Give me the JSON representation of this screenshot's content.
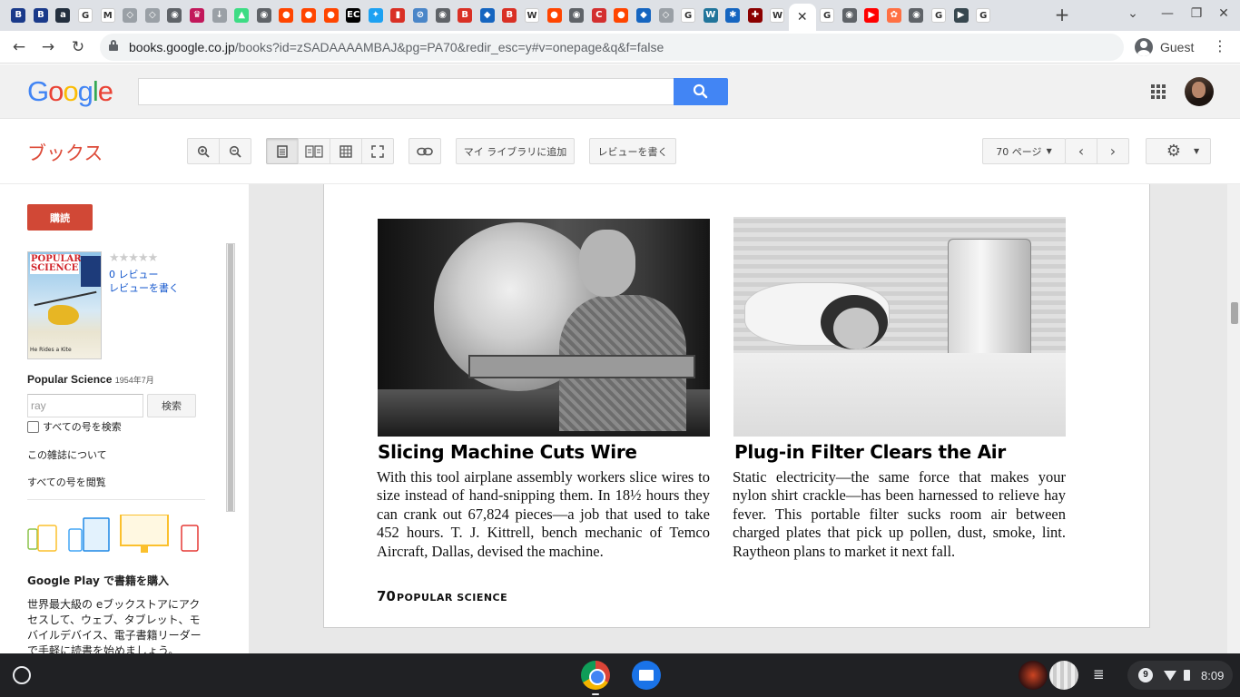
{
  "browser": {
    "tab_favicons": [
      {
        "icon": "bandai-icon",
        "color": "#1a3a8a",
        "glyph": "B"
      },
      {
        "icon": "bandai-icon",
        "color": "#1a3a8a",
        "glyph": "B"
      },
      {
        "icon": "amazon-icon",
        "color": "#232f3e",
        "glyph": "a"
      },
      {
        "icon": "google-icon",
        "color": "#ffffff",
        "glyph": "G"
      },
      {
        "icon": "gmail-icon",
        "color": "#ffffff",
        "glyph": "M"
      },
      {
        "icon": "shield-icon",
        "color": "#9aa0a6",
        "glyph": "◇"
      },
      {
        "icon": "shield-icon",
        "color": "#9aa0a6",
        "glyph": "◇"
      },
      {
        "icon": "globe-icon",
        "color": "#5f6368",
        "glyph": "◉"
      },
      {
        "icon": "crest-icon",
        "color": "#c2185b",
        "glyph": "♛"
      },
      {
        "icon": "arrow-icon",
        "color": "#9aa0a6",
        "glyph": "↓"
      },
      {
        "icon": "android-icon",
        "color": "#3ddc84",
        "glyph": "▲"
      },
      {
        "icon": "globe-icon",
        "color": "#5f6368",
        "glyph": "◉"
      },
      {
        "icon": "reddit-icon",
        "color": "#ff4500",
        "glyph": "●"
      },
      {
        "icon": "reddit-icon",
        "color": "#ff4500",
        "glyph": "●"
      },
      {
        "icon": "reddit-icon",
        "color": "#ff4500",
        "glyph": "●"
      },
      {
        "icon": "ec-icon",
        "color": "#000000",
        "glyph": "EC"
      },
      {
        "icon": "twitter-icon",
        "color": "#1da1f2",
        "glyph": "✦"
      },
      {
        "icon": "chart-icon",
        "color": "#d93025",
        "glyph": "▮"
      },
      {
        "icon": "slash-icon",
        "color": "#4a86c8",
        "glyph": "⊘"
      },
      {
        "icon": "globe-icon",
        "color": "#5f6368",
        "glyph": "◉"
      },
      {
        "icon": "books-icon",
        "color": "#d93025",
        "glyph": "B"
      },
      {
        "icon": "badge-icon",
        "color": "#1565c0",
        "glyph": "◆"
      },
      {
        "icon": "books-icon",
        "color": "#d93025",
        "glyph": "B"
      },
      {
        "icon": "wikipedia-icon",
        "color": "#ffffff",
        "glyph": "W"
      },
      {
        "icon": "reddit-icon",
        "color": "#ff4500",
        "glyph": "●"
      },
      {
        "icon": "globe-icon",
        "color": "#5f6368",
        "glyph": "◉"
      },
      {
        "icon": "c-icon",
        "color": "#d32f2f",
        "glyph": "C"
      },
      {
        "icon": "reddit-icon",
        "color": "#ff4500",
        "glyph": "●"
      },
      {
        "icon": "badge-icon",
        "color": "#1565c0",
        "glyph": "◆"
      },
      {
        "icon": "shield-icon",
        "color": "#9aa0a6",
        "glyph": "◇"
      },
      {
        "icon": "google-icon",
        "color": "#ffffff",
        "glyph": "G"
      },
      {
        "icon": "wordpress-icon",
        "color": "#21759b",
        "glyph": "W"
      },
      {
        "icon": "snowflake-icon",
        "color": "#1565c0",
        "glyph": "✱"
      },
      {
        "icon": "cross-icon",
        "color": "#8b0000",
        "glyph": "✚"
      },
      {
        "icon": "wikipedia-icon",
        "color": "#ffffff",
        "glyph": "W"
      }
    ],
    "tab_favicons_after": [
      {
        "icon": "google-icon",
        "color": "#ffffff",
        "glyph": "G"
      },
      {
        "icon": "globe-icon",
        "color": "#5f6368",
        "glyph": "◉"
      },
      {
        "icon": "youtube-icon",
        "color": "#ff0000",
        "glyph": "▶"
      },
      {
        "icon": "pinwheel-icon",
        "color": "#ff7043",
        "glyph": "✿"
      },
      {
        "icon": "globe-icon",
        "color": "#5f6368",
        "glyph": "◉"
      },
      {
        "icon": "google-icon",
        "color": "#ffffff",
        "glyph": "G"
      },
      {
        "icon": "slides-icon",
        "color": "#37474f",
        "glyph": "▶"
      },
      {
        "icon": "google-icon",
        "color": "#ffffff",
        "glyph": "G"
      }
    ],
    "active_tab_close": "✕",
    "new_tab": "+",
    "url_host": "books.google.co.jp",
    "url_path": "/books?id=zSADAAAAMBAJ&pg=PA70&redir_esc=y#v=onepage&q&f=false",
    "profile_label": "Guest"
  },
  "google": {
    "logo_letters": [
      {
        "ch": "G",
        "color": "#4285f4"
      },
      {
        "ch": "o",
        "color": "#ea4335"
      },
      {
        "ch": "o",
        "color": "#fbbc05"
      },
      {
        "ch": "g",
        "color": "#4285f4"
      },
      {
        "ch": "l",
        "color": "#34a853"
      },
      {
        "ch": "e",
        "color": "#ea4335"
      }
    ],
    "search_value": ""
  },
  "books_bar": {
    "title": "ブックス",
    "add_library": "マイ ライブラリに追加",
    "write_review": "レビューを書く",
    "page_select": "70 ページ"
  },
  "sidebar": {
    "subscribe": "購読",
    "stars": "★★★★★",
    "review_count": "0 レビュー",
    "write_review": "レビューを書く",
    "magazine_name": "Popular Science",
    "magazine_date": "1954年7月",
    "search_placeholder": "ray",
    "search_button": "検索",
    "all_issues_checkbox": "すべての号を検索",
    "about": "この雑誌について",
    "browse_all": "すべての号を閲覧",
    "play_title": "Google Play で書籍を購入",
    "play_desc": "世界最大級の eブックストアにアクセスして、ウェブ、タブレット、モバイルデバイス、電子書籍リーダーで手軽に読書を始めましょう。",
    "cover": {
      "masthead": "POPULAR SCIENCE",
      "tagline": "He Rides a Kite"
    }
  },
  "page": {
    "left": {
      "headline": "Slicing Machine Cuts Wire",
      "body": "With this tool airplane assembly workers slice wires to size instead of hand-snipping them. In 18½ hours they can crank out 67,824 pieces—a job that used to take 452 hours. T. J. Kittrell, bench mechanic of Temco Aircraft, Dallas, devised the machine."
    },
    "right": {
      "headline": "Plug-in Filter Clears the Air",
      "body": "Static electricity—the same force that makes your nylon shirt crackle—has been harnessed to relieve hay fever. This portable filter sucks room air between charged plates that pick up pollen, dust, smoke, lint. Raytheon plans to market it next fall."
    },
    "number": "70",
    "magazine": "POPULAR SCIENCE"
  },
  "shelf": {
    "notification_count": "9",
    "time": "8:09"
  }
}
